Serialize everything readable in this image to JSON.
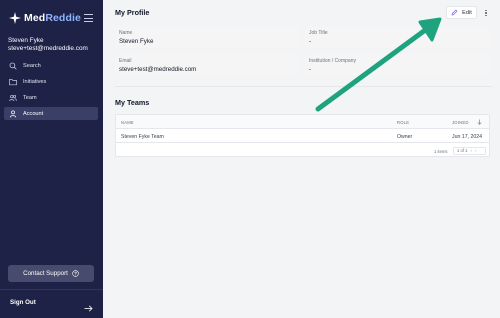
{
  "brand": {
    "name_prefix": "Med",
    "name_suffix": "Reddie"
  },
  "user": {
    "name": "Steven Fyke",
    "email": "steve+test@medreddie.com"
  },
  "nav": {
    "items": [
      {
        "label": "Search",
        "icon": "search-icon"
      },
      {
        "label": "Initiatives",
        "icon": "folder-icon"
      },
      {
        "label": "Team",
        "icon": "users-icon"
      },
      {
        "label": "Account",
        "icon": "person-icon",
        "active": true
      }
    ]
  },
  "support": {
    "label": "Contact Support"
  },
  "signout": {
    "label": "Sign Out"
  },
  "profile": {
    "title": "My Profile",
    "edit_label": "Edit",
    "fields": [
      {
        "label": "Name",
        "value": "Steven Fyke"
      },
      {
        "label": "Job Title",
        "value": "-"
      },
      {
        "label": "Email",
        "value": "steve+test@medreddie.com"
      },
      {
        "label": "Institution / Company",
        "value": "-"
      }
    ]
  },
  "teams": {
    "title": "My Teams",
    "columns": [
      "NAME",
      "ROLE",
      "JOINED"
    ],
    "rows": [
      {
        "name": "Steven Fyke Team",
        "role": "Owner",
        "joined": "Jun 17, 2024"
      }
    ],
    "pagination": {
      "count": "1 items",
      "page": "1 of 1"
    }
  },
  "colors": {
    "sidebar_bg": "#1e2247",
    "accent": "#7c5cff",
    "annotation_arrow": "#1fa37f"
  }
}
